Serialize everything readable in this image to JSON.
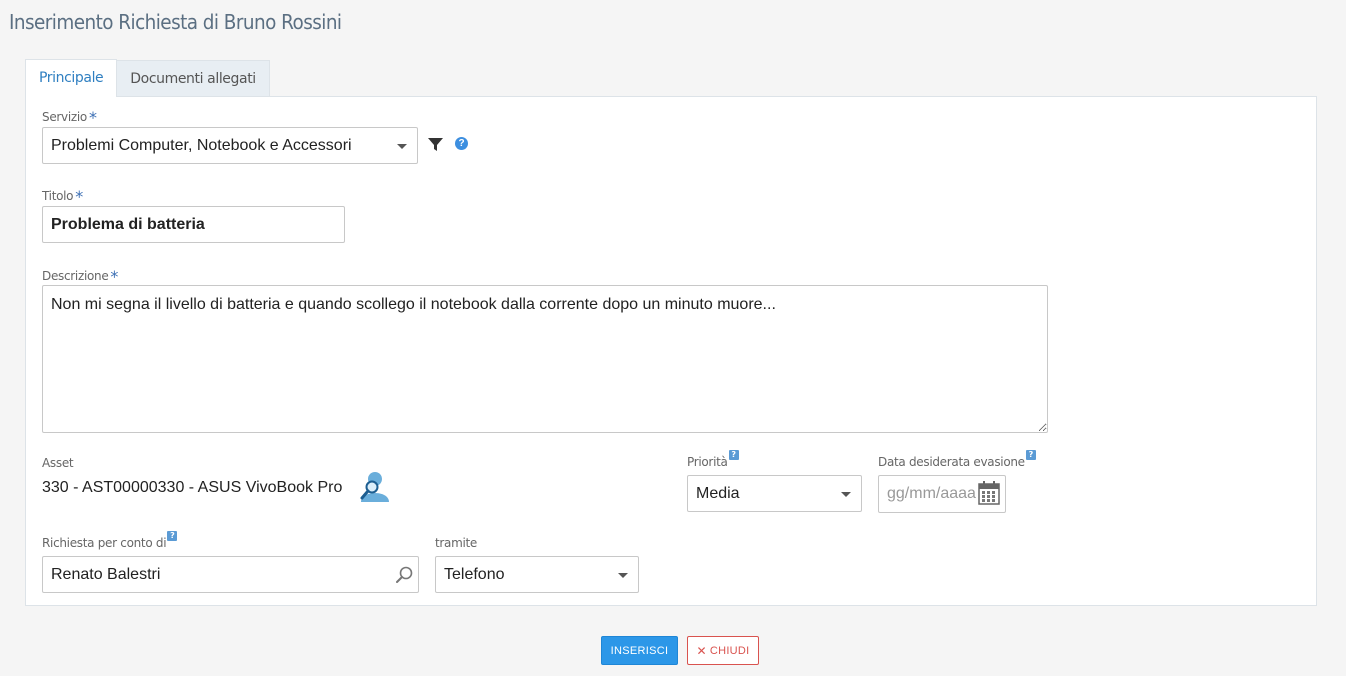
{
  "page": {
    "title": "Inserimento Richiesta di Bruno Rossini"
  },
  "tabs": [
    {
      "label": "Principale",
      "active": true
    },
    {
      "label": "Documenti allegati",
      "active": false
    }
  ],
  "form": {
    "servizio": {
      "label": "Servizio",
      "required": "*",
      "value": "Problemi Computer, Notebook e Accessori",
      "filter_icon": "filter-icon",
      "help_icon": "help-icon",
      "help_glyph": "?"
    },
    "titolo": {
      "label": "Titolo",
      "required": "*",
      "value": "Problema di batteria"
    },
    "descrizione": {
      "label": "Descrizione",
      "required": "*",
      "value": "Non mi segna il livello di batteria e quando scollego il notebook dalla corrente dopo un minuto muore..."
    },
    "asset": {
      "label": "Asset",
      "value": "330 - AST00000330 - ASUS VivoBook Pro",
      "search_icon": "user-search-icon"
    },
    "priorita": {
      "label": "Priorità",
      "help": "?",
      "value": "Media"
    },
    "data_evasione": {
      "label": "Data desiderata evasione",
      "help": "?",
      "placeholder": "gg/mm/aaaa",
      "icon": "calendar-icon"
    },
    "richiesta_per_conto_di": {
      "label": "Richiesta per conto di",
      "help": "?",
      "value": "Renato Balestri",
      "icon": "magnifier-icon"
    },
    "tramite": {
      "label": "tramite",
      "value": "Telefono"
    }
  },
  "actions": {
    "inserisci": "INSERISCI",
    "chiudi_glyph": "✕",
    "chiudi": "CHIUDI"
  },
  "colors": {
    "accent": "#2c97e8",
    "close": "#d9534f",
    "title": "#5b6f82",
    "required": "#3c6fb4"
  }
}
